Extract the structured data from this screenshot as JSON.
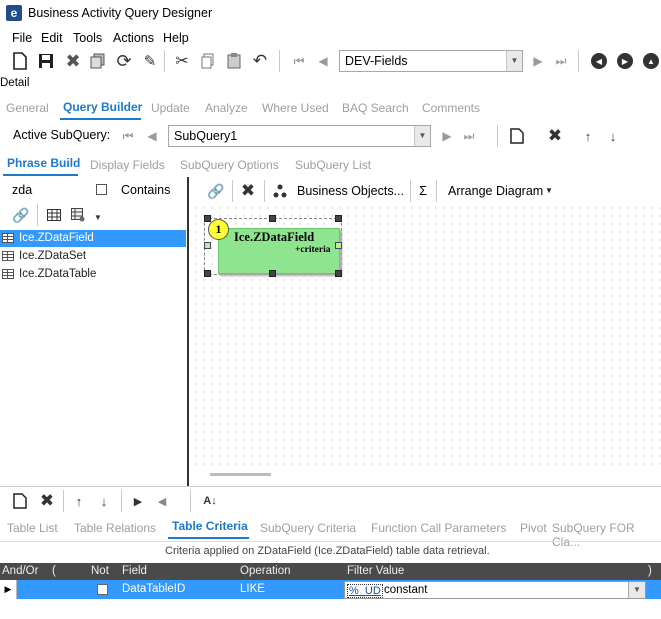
{
  "window": {
    "title": "Business Activity Query Designer",
    "icon_letter": "e"
  },
  "menu": [
    "File",
    "Edit",
    "Tools",
    "Actions",
    "Help"
  ],
  "toolbar": {
    "field_combo": "DEV-Fields"
  },
  "section_label": "Detail",
  "main_tabs": [
    {
      "label": "General",
      "active": false
    },
    {
      "label": "Query Builder",
      "active": true
    },
    {
      "label": "Update",
      "active": false
    },
    {
      "label": "Analyze",
      "active": false
    },
    {
      "label": "Where Used",
      "active": false
    },
    {
      "label": "BAQ Search",
      "active": false
    },
    {
      "label": "Comments",
      "active": false
    }
  ],
  "subquery": {
    "label": "Active SubQuery:",
    "value": "SubQuery1"
  },
  "sub_tabs": [
    {
      "label": "Phrase Build",
      "active": true
    },
    {
      "label": "Display Fields",
      "active": false
    },
    {
      "label": "SubQuery Options",
      "active": false
    },
    {
      "label": "SubQuery List",
      "active": false
    }
  ],
  "search": {
    "value": "zda",
    "contains_label": "Contains"
  },
  "tree_items": [
    {
      "label": "Ice.ZDataField",
      "selected": true
    },
    {
      "label": "Ice.ZDataSet",
      "selected": false
    },
    {
      "label": "Ice.ZDataTable",
      "selected": false
    }
  ],
  "diagram_toolbar": {
    "business_objects": "Business Objects...",
    "sigma": "Σ",
    "arrange": "Arrange Diagram"
  },
  "diagram_node": {
    "badge": "1",
    "title": "Ice.ZDataField",
    "subtitle": "+criteria"
  },
  "bottom_tabs": [
    {
      "label": "Table List",
      "active": false
    },
    {
      "label": "Table Relations",
      "active": false
    },
    {
      "label": "Table Criteria",
      "active": true
    },
    {
      "label": "SubQuery Criteria",
      "active": false
    },
    {
      "label": "Function Call Parameters",
      "active": false
    },
    {
      "label": "Pivot",
      "active": false
    },
    {
      "label": "SubQuery FOR Cla...",
      "active": false
    }
  ],
  "criteria_caption": "Criteria applied on ZDataField (Ice.ZDataField)  table data retrieval.",
  "grid": {
    "headers": [
      "And/Or",
      "(",
      "Not",
      "Field",
      "Operation",
      "Filter Value",
      ")"
    ],
    "row": {
      "andor": "",
      "open": "",
      "not": false,
      "field": "DataTableID",
      "operation": "LIKE",
      "filter_prefix": "%_UD",
      "filter_value": "constant"
    }
  },
  "colors": {
    "accent": "#1f78c8",
    "selection": "#3399ff",
    "node_fill": "#8fe48f",
    "grid_header": "#4a4a4a"
  }
}
